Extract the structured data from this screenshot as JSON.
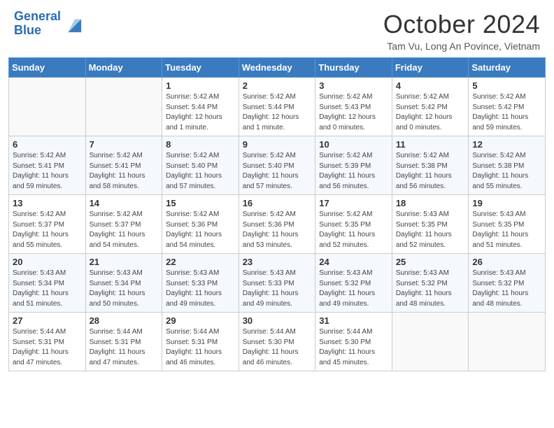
{
  "header": {
    "logo_line1": "General",
    "logo_line2": "Blue",
    "month": "October 2024",
    "location": "Tam Vu, Long An Povince, Vietnam"
  },
  "days_of_week": [
    "Sunday",
    "Monday",
    "Tuesday",
    "Wednesday",
    "Thursday",
    "Friday",
    "Saturday"
  ],
  "weeks": [
    [
      {
        "day": "",
        "info": ""
      },
      {
        "day": "",
        "info": ""
      },
      {
        "day": "1",
        "info": "Sunrise: 5:42 AM\nSunset: 5:44 PM\nDaylight: 12 hours\nand 1 minute."
      },
      {
        "day": "2",
        "info": "Sunrise: 5:42 AM\nSunset: 5:44 PM\nDaylight: 12 hours\nand 1 minute."
      },
      {
        "day": "3",
        "info": "Sunrise: 5:42 AM\nSunset: 5:43 PM\nDaylight: 12 hours\nand 0 minutes."
      },
      {
        "day": "4",
        "info": "Sunrise: 5:42 AM\nSunset: 5:42 PM\nDaylight: 12 hours\nand 0 minutes."
      },
      {
        "day": "5",
        "info": "Sunrise: 5:42 AM\nSunset: 5:42 PM\nDaylight: 11 hours\nand 59 minutes."
      }
    ],
    [
      {
        "day": "6",
        "info": "Sunrise: 5:42 AM\nSunset: 5:41 PM\nDaylight: 11 hours\nand 59 minutes."
      },
      {
        "day": "7",
        "info": "Sunrise: 5:42 AM\nSunset: 5:41 PM\nDaylight: 11 hours\nand 58 minutes."
      },
      {
        "day": "8",
        "info": "Sunrise: 5:42 AM\nSunset: 5:40 PM\nDaylight: 11 hours\nand 57 minutes."
      },
      {
        "day": "9",
        "info": "Sunrise: 5:42 AM\nSunset: 5:40 PM\nDaylight: 11 hours\nand 57 minutes."
      },
      {
        "day": "10",
        "info": "Sunrise: 5:42 AM\nSunset: 5:39 PM\nDaylight: 11 hours\nand 56 minutes."
      },
      {
        "day": "11",
        "info": "Sunrise: 5:42 AM\nSunset: 5:38 PM\nDaylight: 11 hours\nand 56 minutes."
      },
      {
        "day": "12",
        "info": "Sunrise: 5:42 AM\nSunset: 5:38 PM\nDaylight: 11 hours\nand 55 minutes."
      }
    ],
    [
      {
        "day": "13",
        "info": "Sunrise: 5:42 AM\nSunset: 5:37 PM\nDaylight: 11 hours\nand 55 minutes."
      },
      {
        "day": "14",
        "info": "Sunrise: 5:42 AM\nSunset: 5:37 PM\nDaylight: 11 hours\nand 54 minutes."
      },
      {
        "day": "15",
        "info": "Sunrise: 5:42 AM\nSunset: 5:36 PM\nDaylight: 11 hours\nand 54 minutes."
      },
      {
        "day": "16",
        "info": "Sunrise: 5:42 AM\nSunset: 5:36 PM\nDaylight: 11 hours\nand 53 minutes."
      },
      {
        "day": "17",
        "info": "Sunrise: 5:42 AM\nSunset: 5:35 PM\nDaylight: 11 hours\nand 52 minutes."
      },
      {
        "day": "18",
        "info": "Sunrise: 5:43 AM\nSunset: 5:35 PM\nDaylight: 11 hours\nand 52 minutes."
      },
      {
        "day": "19",
        "info": "Sunrise: 5:43 AM\nSunset: 5:35 PM\nDaylight: 11 hours\nand 51 minutes."
      }
    ],
    [
      {
        "day": "20",
        "info": "Sunrise: 5:43 AM\nSunset: 5:34 PM\nDaylight: 11 hours\nand 51 minutes."
      },
      {
        "day": "21",
        "info": "Sunrise: 5:43 AM\nSunset: 5:34 PM\nDaylight: 11 hours\nand 50 minutes."
      },
      {
        "day": "22",
        "info": "Sunrise: 5:43 AM\nSunset: 5:33 PM\nDaylight: 11 hours\nand 49 minutes."
      },
      {
        "day": "23",
        "info": "Sunrise: 5:43 AM\nSunset: 5:33 PM\nDaylight: 11 hours\nand 49 minutes."
      },
      {
        "day": "24",
        "info": "Sunrise: 5:43 AM\nSunset: 5:32 PM\nDaylight: 11 hours\nand 49 minutes."
      },
      {
        "day": "25",
        "info": "Sunrise: 5:43 AM\nSunset: 5:32 PM\nDaylight: 11 hours\nand 48 minutes."
      },
      {
        "day": "26",
        "info": "Sunrise: 5:43 AM\nSunset: 5:32 PM\nDaylight: 11 hours\nand 48 minutes."
      }
    ],
    [
      {
        "day": "27",
        "info": "Sunrise: 5:44 AM\nSunset: 5:31 PM\nDaylight: 11 hours\nand 47 minutes."
      },
      {
        "day": "28",
        "info": "Sunrise: 5:44 AM\nSunset: 5:31 PM\nDaylight: 11 hours\nand 47 minutes."
      },
      {
        "day": "29",
        "info": "Sunrise: 5:44 AM\nSunset: 5:31 PM\nDaylight: 11 hours\nand 46 minutes."
      },
      {
        "day": "30",
        "info": "Sunrise: 5:44 AM\nSunset: 5:30 PM\nDaylight: 11 hours\nand 46 minutes."
      },
      {
        "day": "31",
        "info": "Sunrise: 5:44 AM\nSunset: 5:30 PM\nDaylight: 11 hours\nand 45 minutes."
      },
      {
        "day": "",
        "info": ""
      },
      {
        "day": "",
        "info": ""
      }
    ]
  ]
}
